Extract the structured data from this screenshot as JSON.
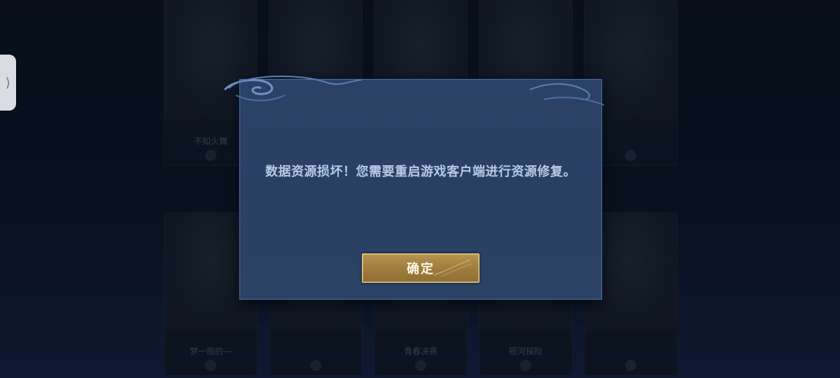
{
  "dialog": {
    "message": "数据资源损坏！您需要重启游戏客户端进行资源修复。",
    "confirm_label": "确定"
  },
  "side_tab": {
    "glyph": "⟩"
  },
  "background": {
    "cards_top": [
      {
        "name": "不知火舞"
      },
      {
        "name": ""
      },
      {
        "name": ""
      },
      {
        "name": ""
      },
      {
        "name": ""
      }
    ],
    "cards_bottom": [
      {
        "name": "梦一般的—"
      },
      {
        "name": ""
      },
      {
        "name": "青春决赛"
      },
      {
        "name": "银河探险"
      },
      {
        "name": ""
      }
    ]
  },
  "colors": {
    "dialog_bg": "#2b4266",
    "dialog_border": "#4d6f9b",
    "message_text": "#b7c9e6",
    "button_gold": "#a17f3f",
    "button_border": "#e8cd86"
  }
}
